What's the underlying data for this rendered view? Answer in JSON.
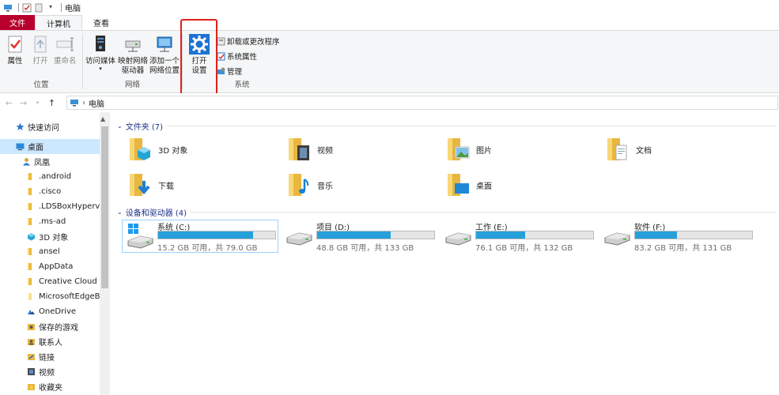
{
  "window": {
    "title": "电脑"
  },
  "tabs": {
    "file": "文件",
    "computer": "计算机",
    "view": "查看"
  },
  "ribbon": {
    "location": {
      "label": "位置",
      "properties": "属性",
      "open": "打开",
      "rename": "重命名"
    },
    "network": {
      "label": "网络",
      "access_media": "访问媒体",
      "map_drive_l1": "映射网络",
      "map_drive_l2": "驱动器",
      "add_location_l1": "添加一个",
      "add_location_l2": "网络位置"
    },
    "system": {
      "label": "系统",
      "open_settings_l1": "打开",
      "open_settings_l2": "设置",
      "uninstall": "卸载或更改程序",
      "system_properties": "系统属性",
      "manage": "管理"
    }
  },
  "address": {
    "path": "电脑"
  },
  "sidebar": {
    "items": [
      {
        "label": "快速访问",
        "icon": "star-icon"
      },
      {
        "label": "桌面",
        "icon": "desktop-icon",
        "selected": true
      },
      {
        "label": "凤凰",
        "icon": "user-icon"
      },
      {
        "label": ".android",
        "icon": "folder-icon"
      },
      {
        "label": ".cisco",
        "icon": "folder-icon"
      },
      {
        "label": ".LDSBoxHypervis",
        "icon": "folder-icon"
      },
      {
        "label": ".ms-ad",
        "icon": "folder-icon"
      },
      {
        "label": "3D 对象",
        "icon": "3d-objects-icon"
      },
      {
        "label": "ansel",
        "icon": "folder-icon"
      },
      {
        "label": "AppData",
        "icon": "folder-icon"
      },
      {
        "label": "Creative Cloud Fi",
        "icon": "folder-icon"
      },
      {
        "label": "MicrosoftEdgeBa",
        "icon": "folder-icon"
      },
      {
        "label": "OneDrive",
        "icon": "onedrive-icon"
      },
      {
        "label": "保存的游戏",
        "icon": "saved-games-icon"
      },
      {
        "label": "联系人",
        "icon": "contacts-icon"
      },
      {
        "label": "链接",
        "icon": "links-icon"
      },
      {
        "label": "视频",
        "icon": "videos-icon"
      },
      {
        "label": "收藏夹",
        "icon": "favorites-icon"
      }
    ]
  },
  "folders_section": {
    "header": "文件夹 (7)"
  },
  "folders": [
    {
      "label": "3D 对象",
      "icon": "3d-objects-folder-icon"
    },
    {
      "label": "视频",
      "icon": "videos-folder-icon"
    },
    {
      "label": "图片",
      "icon": "pictures-folder-icon"
    },
    {
      "label": "文档",
      "icon": "documents-folder-icon"
    },
    {
      "label": "下载",
      "icon": "downloads-folder-icon"
    },
    {
      "label": "音乐",
      "icon": "music-folder-icon"
    },
    {
      "label": "桌面",
      "icon": "desktop-folder-icon"
    }
  ],
  "drives_section": {
    "header": "设备和驱动器 (4)"
  },
  "drives": [
    {
      "label": "系统 (C:)",
      "free": "15.2 GB 可用，共 79.0 GB",
      "used_fraction": 0.81,
      "icon": "windows-drive-icon"
    },
    {
      "label": "项目 (D:)",
      "free": "48.8 GB 可用，共 133 GB",
      "used_fraction": 0.63,
      "icon": "hard-drive-icon"
    },
    {
      "label": "工作 (E:)",
      "free": "76.1 GB 可用，共 132 GB",
      "used_fraction": 0.42,
      "icon": "hard-drive-icon"
    },
    {
      "label": "软件 (F:)",
      "free": "83.2 GB 可用，共 131 GB",
      "used_fraction": 0.36,
      "icon": "hard-drive-icon"
    }
  ],
  "colors": {
    "file_tab": "#b8002d",
    "selection": "#cce8ff",
    "drive_bar": "#26a0da",
    "section_header": "#1e3287",
    "highlight_box": "#e0201b"
  }
}
